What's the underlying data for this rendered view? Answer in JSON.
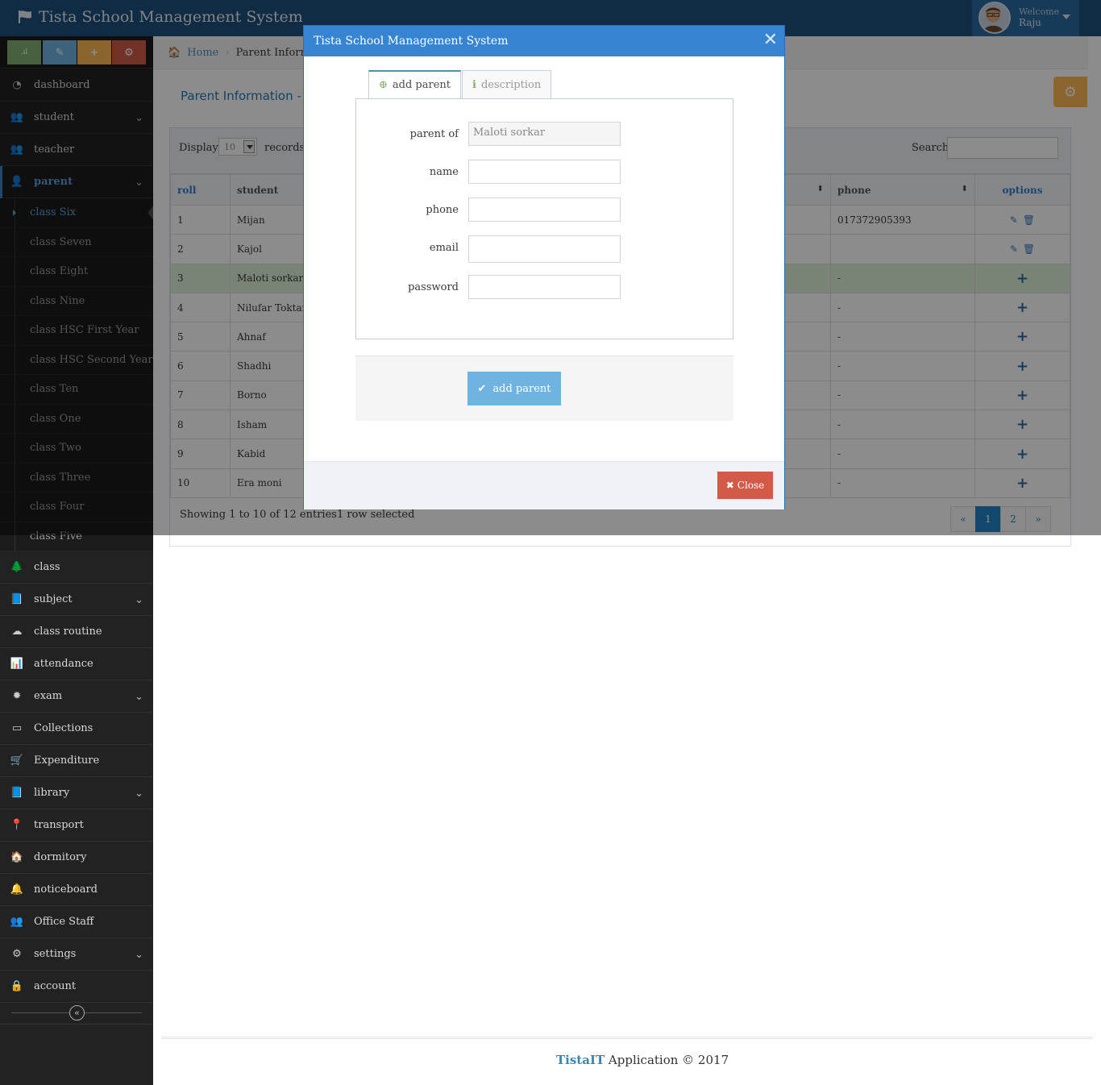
{
  "navbar": {
    "title": "Tista School Management System",
    "welcome_label": "Welcome",
    "user_name": "Raju"
  },
  "sidebar": {
    "shortcuts": [
      {
        "icon": "signal-icon",
        "color": "#82af6f"
      },
      {
        "icon": "pencil-icon",
        "color": "#6fb3e0"
      },
      {
        "icon": "plus-icon",
        "color": "#ffb752"
      },
      {
        "icon": "cogs-icon",
        "color": "#d15b47"
      }
    ],
    "items_top": [
      {
        "label": "dashboard",
        "icon": "dashboard-icon"
      },
      {
        "label": "student",
        "icon": "users-icon",
        "has_children": true
      },
      {
        "label": "teacher",
        "icon": "users-icon"
      },
      {
        "label": "parent",
        "icon": "user-icon",
        "has_children": true,
        "active": true
      }
    ],
    "parent_submenu": [
      "class Six",
      "class Seven",
      "class Eight",
      "class Nine",
      "class HSC First Year",
      "class HSC Second Year",
      "class Ten",
      "class One",
      "class Two",
      "class Three",
      "class Four",
      "class Five"
    ],
    "active_submenu": "class Six",
    "items_bottom": [
      {
        "label": "class",
        "icon": "tree-icon"
      },
      {
        "label": "subject",
        "icon": "book-icon",
        "has_children": true
      },
      {
        "label": "class routine",
        "icon": "cloud-icon"
      },
      {
        "label": "attendance",
        "icon": "bar-chart-icon"
      },
      {
        "label": "exam",
        "icon": "gear-burst-icon",
        "has_children": true
      },
      {
        "label": "Collections",
        "icon": "credit-card-icon"
      },
      {
        "label": "Expenditure",
        "icon": "cart-icon"
      },
      {
        "label": "library",
        "icon": "book-icon",
        "has_children": true
      },
      {
        "label": "transport",
        "icon": "map-marker-icon"
      },
      {
        "label": "dormitory",
        "icon": "home-icon"
      },
      {
        "label": "noticeboard",
        "icon": "bell-icon"
      },
      {
        "label": "Office Staff",
        "icon": "users-icon"
      },
      {
        "label": "settings",
        "icon": "gear-icon",
        "has_children": true
      },
      {
        "label": "account",
        "icon": "lock-icon"
      }
    ]
  },
  "breadcrumb": {
    "home": "Home",
    "current": "Parent Informatio"
  },
  "page": {
    "title": "Parent Information - clas"
  },
  "table": {
    "display_label": "Display",
    "display_value": "10",
    "records_label": "records",
    "search_label": "Search:",
    "columns": [
      "roll",
      "student",
      "phone",
      "options"
    ],
    "rows": [
      {
        "roll": "1",
        "student": "Mijan",
        "phone": "017372905393",
        "has_parent": true
      },
      {
        "roll": "2",
        "student": "Kajol",
        "phone": "",
        "has_parent": true
      },
      {
        "roll": "3",
        "student": "Maloti sorkar",
        "phone": "-",
        "has_parent": false,
        "selected": true
      },
      {
        "roll": "4",
        "student": "Nilufar Toktar",
        "phone": "-",
        "has_parent": false
      },
      {
        "roll": "5",
        "student": "Ahnaf",
        "phone": "-",
        "has_parent": false
      },
      {
        "roll": "6",
        "student": "Shadhi",
        "phone": "-",
        "has_parent": false
      },
      {
        "roll": "7",
        "student": "Borno",
        "phone": "-",
        "has_parent": false
      },
      {
        "roll": "8",
        "student": "Isham",
        "phone": "-",
        "has_parent": false
      },
      {
        "roll": "9",
        "student": "Kabid",
        "phone": "-",
        "has_parent": false
      },
      {
        "roll": "10",
        "student": "Era moni",
        "phone": "-",
        "has_parent": false
      }
    ],
    "showing_text": "Showing 1 to 10 of 12 entries1 row selected",
    "pager": [
      "«",
      "1",
      "2",
      "»"
    ],
    "current_page": "1"
  },
  "modal": {
    "title": "Tista School Management System",
    "tabs": [
      {
        "label": "add parent",
        "icon": "plus-circle-icon"
      },
      {
        "label": "description",
        "icon": "info-icon"
      }
    ],
    "fields": [
      {
        "label": "parent of",
        "value": "Maloti sorkar",
        "placeholder": "",
        "readonly": true
      },
      {
        "label": "name",
        "value": "",
        "placeholder": ""
      },
      {
        "label": "phone",
        "value": "",
        "placeholder": ""
      },
      {
        "label": "email",
        "value": "",
        "placeholder": ""
      },
      {
        "label": "password",
        "value": "",
        "placeholder": ""
      }
    ],
    "submit_label": "add parent",
    "close_label": "Close"
  },
  "footer": {
    "brand": "TistaIT",
    "text": " Application © 2017"
  }
}
